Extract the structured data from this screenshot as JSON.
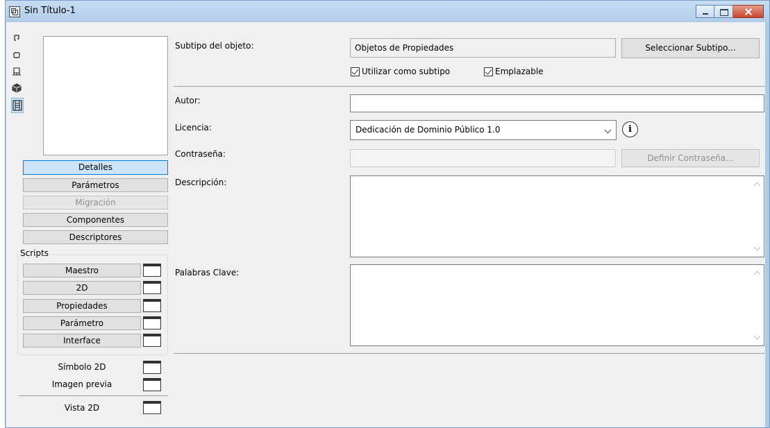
{
  "window": {
    "title": "Sin Título-1"
  },
  "left": {
    "view_icons": [
      "pointer-icon",
      "rect-icon",
      "stamp-icon",
      "cube-icon",
      "film-icon"
    ],
    "tabs": [
      {
        "label": "Detalles",
        "state": "active"
      },
      {
        "label": "Parámetros",
        "state": "normal"
      },
      {
        "label": "Migración",
        "state": "disabled"
      },
      {
        "label": "Componentes",
        "state": "normal"
      },
      {
        "label": "Descriptores",
        "state": "normal"
      }
    ],
    "scripts_label": "Scripts",
    "scripts": [
      "Maestro",
      "2D",
      "Propiedades",
      "Parámetro",
      "Interface"
    ],
    "extras": [
      "Símbolo 2D",
      "Imagen previa"
    ],
    "bottom": [
      "Vista 2D"
    ]
  },
  "form": {
    "subtipo_label": "Subtipo del objeto:",
    "subtipo_value": "Objetos de Propiedades",
    "seleccionar_label": "Seleccionar Subtipo...",
    "cb_utilizar": "Utilizar como subtipo",
    "cb_emplazable": "Emplazable",
    "autor_label": "Autor:",
    "autor_value": "",
    "licencia_label": "Licencia:",
    "licencia_value": "Dedicación de Dominio Público 1.0",
    "contrasena_label": "Contraseña:",
    "definir_label": "Definir Contraseña...",
    "descripcion_label": "Descripción:",
    "palabras_label": "Palabras Clave:"
  },
  "colors": {
    "title_bar": "#b3cde9",
    "active_tab": "#cce4f7",
    "close_button": "#c74631"
  }
}
